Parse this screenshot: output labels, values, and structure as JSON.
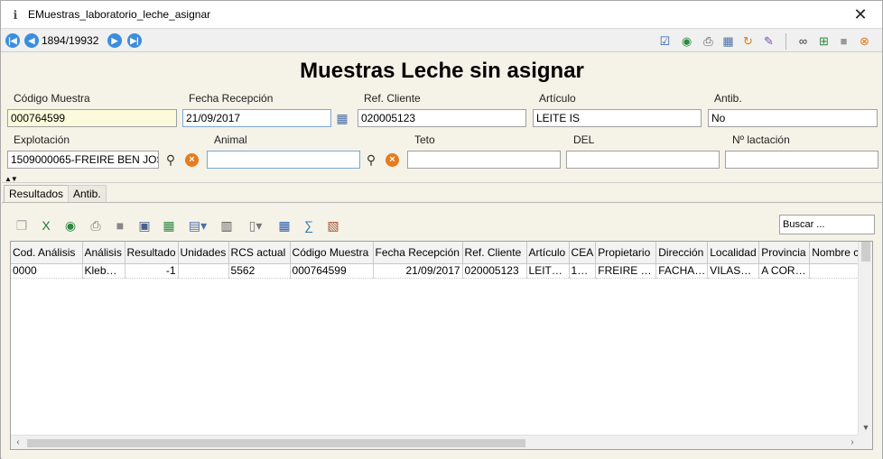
{
  "window": {
    "title": "EMuestras_laboratorio_leche_asignar",
    "close_glyph": "✕",
    "app_icon": "form-icon"
  },
  "nav": {
    "record_counter": "1894/19932",
    "first_glyph": "|◀",
    "prev_glyph": "◀",
    "next_glyph": "▶",
    "last_glyph": "▶|",
    "toolbar_icons": [
      "checklist-icon",
      "globe-icon",
      "print-icon",
      "grid-select-icon",
      "refresh-icon",
      "brush-icon",
      "binoculars-icon",
      "add-record-icon",
      "gray-block-icon",
      "delete-record-icon"
    ]
  },
  "form": {
    "heading": "Muestras Leche sin asignar",
    "codigo_muestra": {
      "label": "Código Muestra",
      "value": "000764599"
    },
    "fecha_recepcion": {
      "label": "Fecha Recepción",
      "value": "21/09/2017"
    },
    "ref_cliente": {
      "label": "Ref. Cliente",
      "value": "020005123"
    },
    "articulo": {
      "label": "Artículo",
      "value": "LEITE IS"
    },
    "antib": {
      "label": "Antib.",
      "value": "No"
    },
    "explotacion": {
      "label": "Explotación",
      "value": "1509000065-FREIRE BEN  JOS"
    },
    "animal": {
      "label": "Animal",
      "value": ""
    },
    "teto": {
      "label": "Teto",
      "value": ""
    },
    "del": {
      "label": "DEL",
      "value": ""
    },
    "lactacion": {
      "label": "Nº lactación",
      "value": ""
    }
  },
  "tabs": [
    {
      "label": "Resultados"
    },
    {
      "label": "Antib."
    }
  ],
  "grid": {
    "search_placeholder": "Buscar ...",
    "toolbar_icons": [
      "copy-icon",
      "excel-icon",
      "globe-icon",
      "print-icon",
      "stamp-icon",
      "save-icon",
      "export-grid-icon",
      "chart-icon",
      "columns-icon",
      "page-icon",
      "calculator-icon",
      "formula-icon",
      "report-icon"
    ],
    "columns": [
      "Cod. Análisis",
      "Análisis",
      "Resultado",
      "Unidades",
      "RCS actual",
      "Código Muestra",
      "Fecha Recepción",
      "Ref. Cliente",
      "Artículo",
      "CEA",
      "Propietario",
      "Dirección",
      "Localidad",
      "Provincia",
      "Nombre c"
    ],
    "rows": [
      [
        "0000",
        "Kleb…",
        "-1",
        "",
        "5562",
        "000764599",
        "21/09/2017",
        "020005123",
        "LEIT…",
        "1…",
        "FREIRE …",
        "FACHA…",
        "VILAS…",
        "A COR…",
        ""
      ]
    ]
  }
}
